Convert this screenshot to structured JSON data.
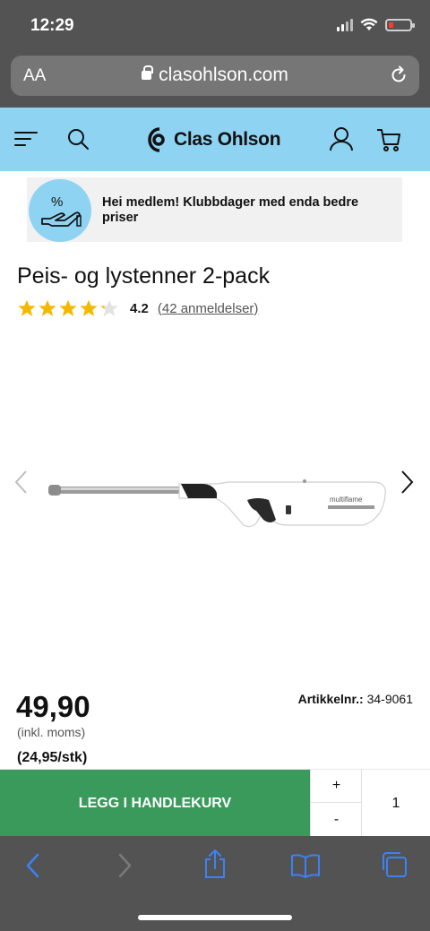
{
  "status_bar": {
    "time": "12:29"
  },
  "browser": {
    "text_size_label": "AA",
    "url": "clasohlson.com"
  },
  "site": {
    "brand_name": "Clas Ohlson",
    "brand_color": "#8fd3f3"
  },
  "banner": {
    "badge_icon": "percent-hand-icon",
    "text": "Hei medlem! Klubbdager med enda bedre priser"
  },
  "product": {
    "title": "Peis- og lystenner 2-pack",
    "rating": {
      "value": "4.2",
      "stars_out_of_5": 4.2,
      "reviews_label": "(42 anmeldelser)"
    },
    "image_brand_text": "multiflame",
    "price": "49,90",
    "price_note": "(inkl. moms)",
    "unit_price": "(24,95/stk)",
    "article_label": "Artikkelnr.:",
    "article_number": "34-9061"
  },
  "cart": {
    "add_label": "LEGG I HANDLEKURV",
    "plus_label": "+",
    "minus_label": "-",
    "quantity": "1",
    "add_color": "#3a9a5b"
  }
}
